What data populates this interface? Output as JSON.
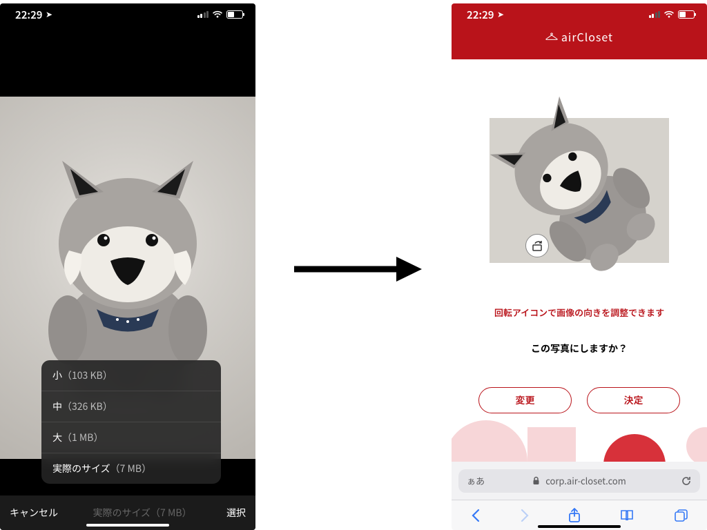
{
  "left": {
    "status": {
      "time": "22:29",
      "location_icon": "➤"
    },
    "popup": [
      {
        "label": "小",
        "size": "（103 KB）"
      },
      {
        "label": "中",
        "size": "（326 KB）"
      },
      {
        "label": "大",
        "size": "（1 MB）"
      },
      {
        "label": "実際のサイズ",
        "size": "（7 MB）"
      }
    ],
    "bottom": {
      "cancel": "キャンセル",
      "mid": "実際のサイズ（7 MB）",
      "select": "選択"
    },
    "alt": "gray-wolf-plush"
  },
  "right": {
    "status": {
      "time": "22:29",
      "location_icon": "➤"
    },
    "brand": "airCloset",
    "hint": "回転アイコンで画像の向きを調整できます",
    "ask": "この写真にしますか？",
    "buttons": {
      "change": "変更",
      "confirm": "決定"
    },
    "alt": "gray-wolf-plush-rotated",
    "address": {
      "aa": "ぁあ",
      "url": "corp.air-closet.com"
    }
  }
}
